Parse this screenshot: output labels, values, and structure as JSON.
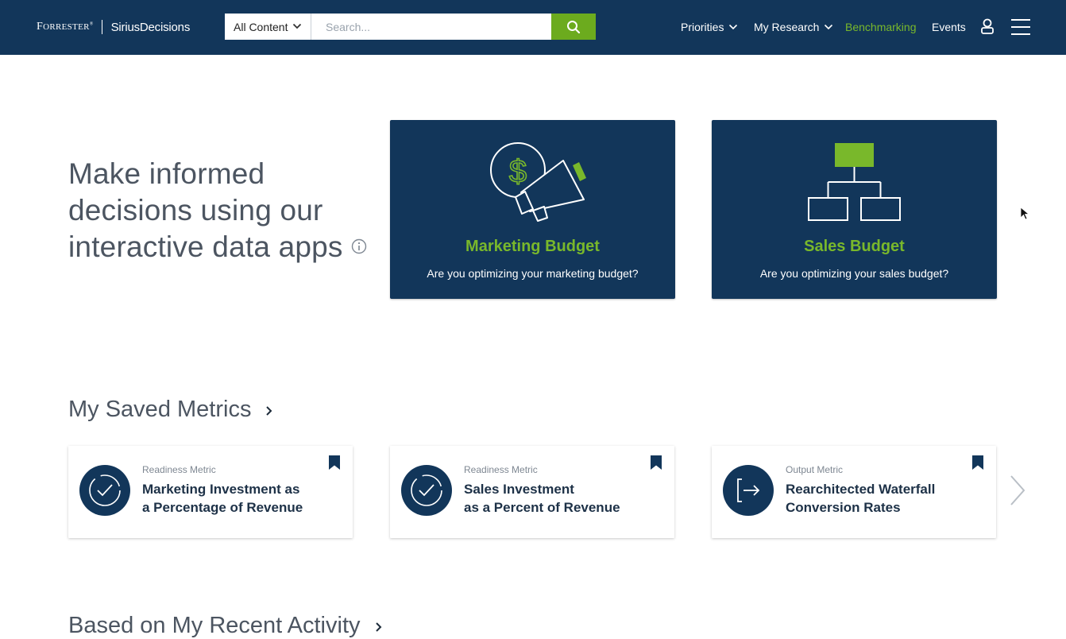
{
  "header": {
    "logo_primary": "Forrester",
    "logo_secondary": "SiriusDecisions",
    "search_scope": "All Content",
    "search_placeholder": "Search...",
    "nav": [
      {
        "label": "Priorities",
        "has_dropdown": true
      },
      {
        "label": "My Research",
        "has_dropdown": true
      },
      {
        "label": "Benchmarking",
        "active": true
      },
      {
        "label": "Events"
      }
    ],
    "icons": {
      "search": "search-icon",
      "user": "user-icon",
      "menu": "hamburger-menu-icon"
    }
  },
  "hero": {
    "title": "Make informed decisions using our interactive data apps",
    "info_icon": "info-icon"
  },
  "apps": [
    {
      "title": "Marketing Budget",
      "subtitle": "Are you optimizing your marketing budget?",
      "icon": "megaphone-dollar-icon"
    },
    {
      "title": "Sales Budget",
      "subtitle": "Are you optimizing your sales budget?",
      "icon": "org-chart-icon"
    }
  ],
  "saved_metrics": {
    "heading": "My Saved Metrics",
    "items": [
      {
        "kind": "Readiness Metric",
        "name_line1": "Marketing Investment as",
        "name_line2": "a Percentage of Revenue",
        "icon": "check-circle-icon"
      },
      {
        "kind": "Readiness Metric",
        "name_line1": "Sales Investment",
        "name_line2": "as a Percent of Revenue",
        "icon": "check-circle-icon"
      },
      {
        "kind": "Output Metric",
        "name_line1": "Rearchitected Waterfall",
        "name_line2": "Conversion Rates",
        "icon": "exit-arrow-icon"
      }
    ]
  },
  "recent_activity": {
    "heading": "Based on My Recent Activity"
  },
  "colors": {
    "navy": "#12365a",
    "green": "#6cab1e",
    "green_text": "#79b82b"
  }
}
